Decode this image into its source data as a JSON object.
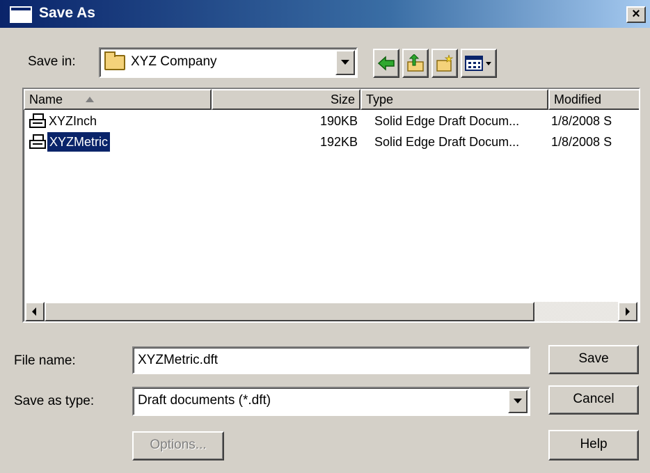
{
  "window": {
    "title": "Save As",
    "close_glyph": "×"
  },
  "save_in": {
    "label": "Save in:",
    "value": "XYZ Company",
    "icon": "folder-icon"
  },
  "toolbar": {
    "back_icon": "back-arrow-icon",
    "up_icon": "up-one-level-icon",
    "new_folder_icon": "new-folder-icon",
    "views_icon": "view-menu-icon"
  },
  "file_list": {
    "columns": [
      {
        "label": "Name",
        "sorted": "ascending"
      },
      {
        "label": "Size"
      },
      {
        "label": "Type"
      },
      {
        "label": "Modified"
      }
    ],
    "rows": [
      {
        "name": "XYZInch",
        "size": "190KB",
        "type": "Solid Edge Draft Docum...",
        "modified": "1/8/2008 S",
        "selected": false
      },
      {
        "name": "XYZMetric",
        "size": "192KB",
        "type": "Solid Edge Draft Docum...",
        "modified": "1/8/2008 S",
        "selected": true
      }
    ]
  },
  "file_name": {
    "label": "File name:",
    "value": "XYZMetric.dft"
  },
  "save_as_type": {
    "label": "Save as type:",
    "value": "Draft documents (*.dft)"
  },
  "buttons": {
    "save": "Save",
    "cancel": "Cancel",
    "help": "Help",
    "options": "Options..."
  },
  "colors": {
    "title_bar": "#0a246a",
    "dialog_face": "#d4d0c8",
    "selection": "#0a246a",
    "folder": "#f4d27a",
    "toolbar_green": "#2fa82f"
  }
}
